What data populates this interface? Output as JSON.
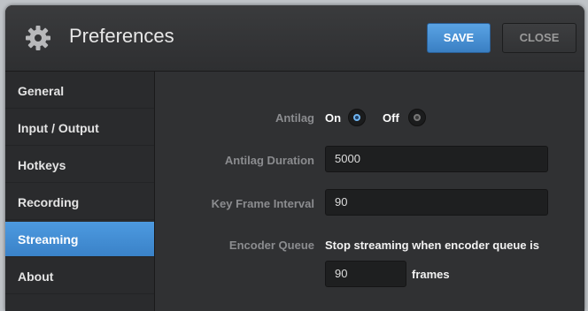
{
  "window": {
    "title": "Preferences"
  },
  "toolbar": {
    "save_label": "SAVE",
    "close_label": "CLOSE"
  },
  "sidebar": {
    "items": [
      {
        "label": "General"
      },
      {
        "label": "Input / Output"
      },
      {
        "label": "Hotkeys"
      },
      {
        "label": "Recording"
      },
      {
        "label": "Streaming",
        "active": true
      },
      {
        "label": "About"
      }
    ]
  },
  "streaming": {
    "antilag": {
      "label": "Antilag",
      "on_label": "On",
      "off_label": "Off",
      "selected": "On"
    },
    "antilag_duration": {
      "label": "Antilag Duration",
      "value": "5000"
    },
    "key_frame_interval": {
      "label": "Key Frame Interval",
      "value": "90"
    },
    "encoder_queue": {
      "label": "Encoder Queue",
      "description": "Stop streaming when encoder queue is",
      "value": "90",
      "unit": "frames"
    }
  },
  "colors": {
    "accent": "#4a95dc",
    "background": "#2c2d2f"
  }
}
